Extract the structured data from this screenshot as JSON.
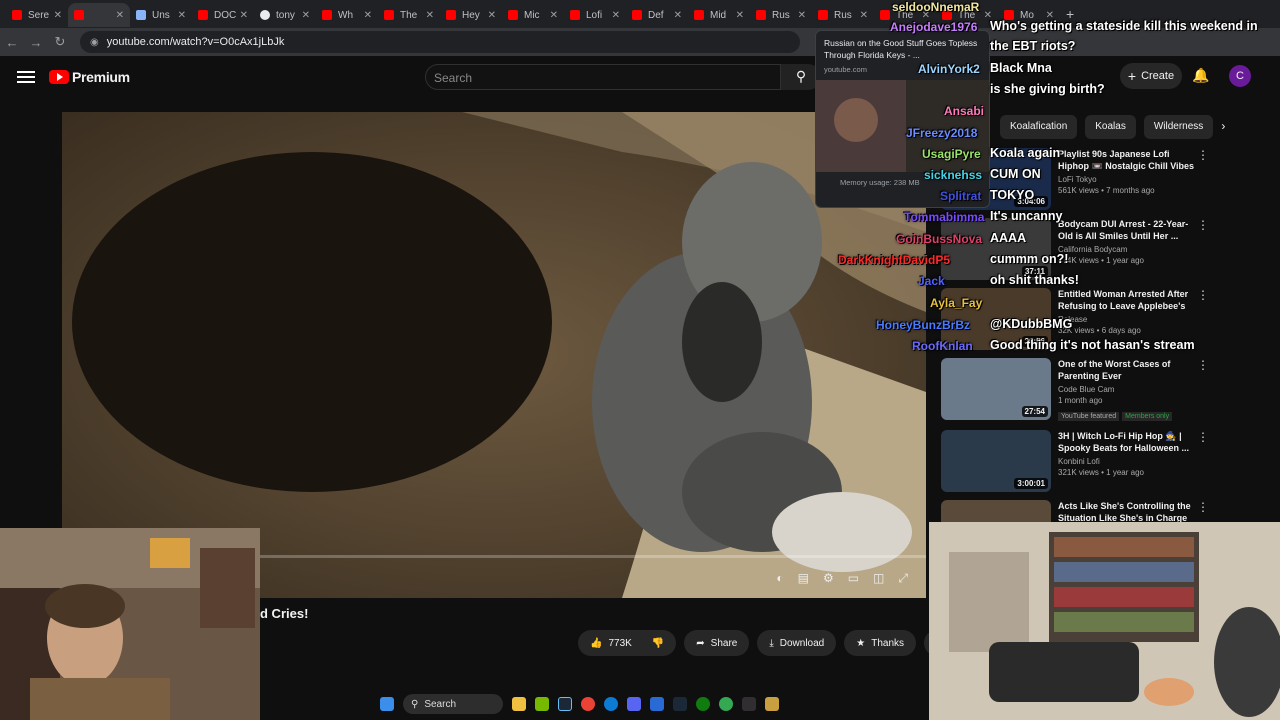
{
  "browser": {
    "tabs": [
      {
        "label": "Sere",
        "fav": "red"
      },
      {
        "label": "",
        "fav": "red",
        "active": true
      },
      {
        "label": "Uns",
        "fav": "gray"
      },
      {
        "label": "DOC",
        "fav": "red"
      },
      {
        "label": "tony",
        "fav": "white"
      },
      {
        "label": "Wh",
        "fav": "red"
      },
      {
        "label": "The",
        "fav": "red"
      },
      {
        "label": "Hey",
        "fav": "red"
      },
      {
        "label": "Mic",
        "fav": "red"
      },
      {
        "label": "Lofi",
        "fav": "red"
      },
      {
        "label": "Def",
        "fav": "red"
      },
      {
        "label": "Mid",
        "fav": "red"
      },
      {
        "label": "Rus",
        "fav": "red"
      },
      {
        "label": "Rus",
        "fav": "red",
        "hovered": true
      },
      {
        "label": "The",
        "fav": "red"
      },
      {
        "label": "The",
        "fav": "red"
      },
      {
        "label": "Mo",
        "fav": "red"
      }
    ],
    "url": "youtube.com/watch?v=O0cAx1jLbJk",
    "tooltip": {
      "title": "Russian on the Good Stuff Goes Topless Through Florida Keys - ...",
      "url": "youtube.com",
      "memory": "Memory usage: 238 MB"
    }
  },
  "youtube": {
    "logo_text": "Premium",
    "search_placeholder": "Search",
    "create_label": "Create",
    "avatar_letter": "C",
    "video_title_visible": "d Cries!",
    "actions": {
      "likes": "773K",
      "share": "Share",
      "download": "Download",
      "thanks": "Thanks"
    },
    "chips": [
      "Koalafication",
      "Koalas",
      "Wilderness"
    ],
    "recommendations": [
      {
        "title": "Playlist 90s Japanese Lofi Hiphop 📼 Nostalgic Chill Vibes",
        "channel": "LoFi Tokyo",
        "meta": "561K views • 7 months ago",
        "duration": "3:04:06",
        "thumb": "#1a2a4a"
      },
      {
        "title": "Bodycam DUI Arrest - 22-Year-Old is All Smiles Until Her ...",
        "channel": "California Bodycam",
        "meta": "474K views • 1 year ago",
        "duration": "37:11",
        "thumb": "#3a3a3a"
      },
      {
        "title": "Entitled Woman Arrested After Refusing to Leave Applebee's",
        "channel": "Release",
        "meta": "32K views • 6 days ago",
        "duration": "36:56",
        "thumb": "#4a3a2a"
      },
      {
        "title": "One of the Worst Cases of Parenting Ever",
        "channel": "Code Blue Cam",
        "meta": "1 month ago",
        "duration": "27:54",
        "thumb": "#6a7a8a",
        "badges": [
          "YouTube featured",
          "Members only"
        ]
      },
      {
        "title": "3H | Witch Lo-Fi Hip Hop 🧙 | Spooky Beats for Halloween ...",
        "channel": "Konbini Lofi",
        "meta": "321K views • 1 year ago",
        "duration": "3:00:01",
        "thumb": "#2a3a4a"
      },
      {
        "title": "Acts Like She's Controlling the Situation Like She's in Charge",
        "channel": "",
        "meta": "",
        "duration": "",
        "thumb": "#5a4a3a"
      }
    ]
  },
  "chat": [
    {
      "user": "seldooNnemaR",
      "color": "#f0e6a0",
      "msg": ""
    },
    {
      "user": "Anejodave1976",
      "color": "#c77dff",
      "msg": "Who's getting a stateside kill this weekend in"
    },
    {
      "user": "",
      "color": "#ffffff",
      "msg": "the EBT riots?"
    },
    {
      "user": "AlvinYork2",
      "color": "#9dd5ff",
      "msg": "Black Mna"
    },
    {
      "user": "",
      "color": "#ffffff",
      "msg": "is she giving birth?"
    },
    {
      "user": "Ansabi",
      "color": "#ff7ab8",
      "msg": ""
    },
    {
      "user": "JFreezy2018",
      "color": "#6a8cff",
      "msg": ""
    },
    {
      "user": "UsagiPyre",
      "color": "#9be36a",
      "msg": "Koala again"
    },
    {
      "user": "sicknehss",
      "color": "#46d3e6",
      "msg": "CUM ON"
    },
    {
      "user": "Splitrat",
      "color": "#4050e0",
      "msg": "TOKYO"
    },
    {
      "user": "Tommabimma",
      "color": "#7a4aff",
      "msg": "It's uncanny"
    },
    {
      "user": "GoinBussNova",
      "color": "#e0406a",
      "msg": "AAAA"
    },
    {
      "user": "DarkKnightDavidP5",
      "color": "#ff2a2a",
      "msg": "cummm on?!"
    },
    {
      "user": "Jack",
      "color": "#5060ff",
      "msg": "oh shit thanks!"
    },
    {
      "user": "Ayla_Fay",
      "color": "#e8c040",
      "msg": ""
    },
    {
      "user": "HoneyBunzBrBz",
      "color": "#4a7aff",
      "msg": "@KDubbBMG"
    },
    {
      "user": "RoofKnlan",
      "color": "#6a6aff",
      "msg": "Good thing it's not hasan's stream"
    }
  ],
  "taskbar": {
    "search_label": "Search"
  }
}
